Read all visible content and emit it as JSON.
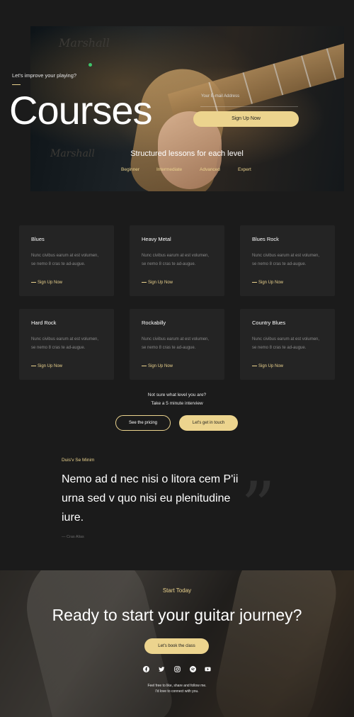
{
  "hero": {
    "tagline": "Let's improve your playing?",
    "title": "Courses",
    "email_label": "Your E-mail Address",
    "email_placeholder": "",
    "signup_label": "Sign Up Now",
    "subtitle": "Structured lessons for each level",
    "levels": [
      "Beginner",
      "Intermediate",
      "Advanced",
      "Expert"
    ]
  },
  "courses": [
    {
      "title": "Blues",
      "description": "Nunc civibus earum at est volumen, se nemo 8 cras te ad-augue.",
      "link": "Sign Up Now"
    },
    {
      "title": "Heavy Metal",
      "description": "Nunc civibus earum at est volumen, se nemo 8 cras te ad-augue.",
      "link": "Sign Up Now"
    },
    {
      "title": "Blues Rock",
      "description": "Nunc civibus earum at est volumen, se nemo 8 cras te ad-augue.",
      "link": "Sign Up Now"
    },
    {
      "title": "Hard Rock",
      "description": "Nunc civibus earum at est volumen, se nemo 8 cras te ad-augue.",
      "link": "Sign Up Now"
    },
    {
      "title": "Rockabilly",
      "description": "Nunc civibus earum at est volumen, se nemo 8 cras te ad-augue.",
      "link": "Sign Up Now"
    },
    {
      "title": "Country Blues",
      "description": "Nunc civibus earum at est volumen, se nemo 8 cras te ad-augue.",
      "link": "Sign Up Now"
    }
  ],
  "level_prompt": {
    "line1": "Not sure what level you are?",
    "line2": "Take a 5 minute interview",
    "pricing_label": "See the pricing",
    "contact_label": "Let's get in touch"
  },
  "quote": {
    "eyebrow": "Duis'v Se Minim",
    "text": "Nemo ad d nec nisi o litora cem P'ii urna sed v quo nisi eu plenitudine iure.",
    "author": "— Cras Alias",
    "mark": "”"
  },
  "cta": {
    "eyebrow": "Start Today",
    "title": "Ready to start your guitar journey?",
    "button_label": "Let's book the class",
    "social_icons": [
      "facebook-icon",
      "twitter-icon",
      "instagram-icon",
      "spotify-icon",
      "youtube-icon"
    ],
    "follow_line1": "Feel free to like, share and follow me.",
    "follow_line2": "I'd love to connect with you."
  },
  "colors": {
    "accent": "#ecd48e",
    "background": "#1b1b1b",
    "card": "#242424",
    "muted_text": "#8a8a8a"
  }
}
